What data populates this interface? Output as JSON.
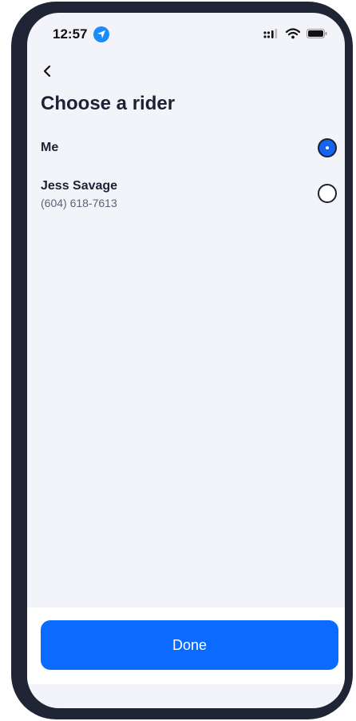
{
  "status_bar": {
    "time": "12:57",
    "icons": [
      "location-arrow-icon",
      "cellular-signal-icon",
      "wifi-icon",
      "battery-icon"
    ]
  },
  "header": {
    "back_icon": "chevron-left-icon",
    "title": "Choose a rider"
  },
  "riders": [
    {
      "name": "Me",
      "phone": "",
      "selected": true
    },
    {
      "name": "Jess Savage",
      "phone": "(604) 618-7613",
      "selected": false
    }
  ],
  "footer": {
    "done_label": "Done"
  },
  "colors": {
    "frame": "#1f2535",
    "screen_bg": "#f3f4f9",
    "accent": "#0b6bff",
    "radio_selected": "#1463f3",
    "text_primary": "#1c2233",
    "text_secondary": "#5a6478"
  }
}
